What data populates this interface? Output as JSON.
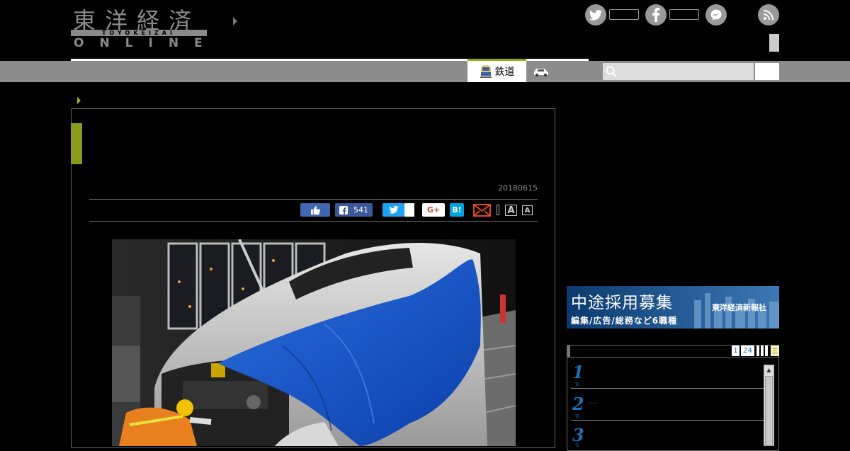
{
  "header": {
    "logo_kanji": "東洋経済",
    "logo_romaji": "TOYOKEIZAI",
    "logo_online": "ONLINE"
  },
  "social": {
    "twitter_icon": "twitter-icon",
    "facebook_icon": "facebook-icon",
    "messenger_icon": "messenger-icon",
    "rss_icon": "rss-icon"
  },
  "nav": {
    "tab_railway_label": "鉄道",
    "search_placeholder": ""
  },
  "article": {
    "date": "20180615",
    "share": {
      "facebook_count": "541",
      "google_label": "G+",
      "hatena_label": "B!"
    },
    "font_large_label": "A",
    "font_small_label": "A"
  },
  "sidebar": {
    "ad": {
      "headline": "中途採用募集",
      "company": "東洋経済新報社",
      "subline": "編集/広告/総務など6職種"
    },
    "ranking": {
      "page_first": "1",
      "page_range": "24",
      "page_last": "三",
      "items": [
        {
          "rank": "1",
          "suffix": "位",
          "text": ""
        },
        {
          "rank": "2",
          "suffix": "位",
          "text": "…"
        },
        {
          "rank": "3",
          "suffix": "位",
          "text": ""
        }
      ]
    }
  },
  "colors": {
    "accent_green": "#8ab000",
    "nav_gray": "#8c8c8c",
    "link_blue": "#1a6fb5",
    "facebook_blue": "#3b5998",
    "twitter_blue": "#1da1f2"
  }
}
